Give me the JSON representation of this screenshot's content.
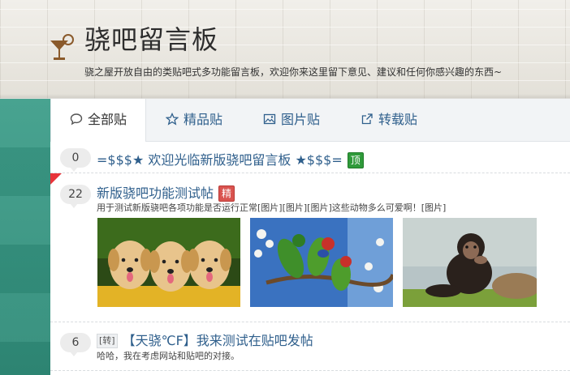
{
  "header": {
    "title": "骁吧留言板",
    "description": "骁之屋开放自由的类贴吧式多功能留言板，欢迎你来这里留下意见、建议和任何你感兴趣的东西~"
  },
  "tabs": [
    {
      "label": "全部贴",
      "icon": "chat-bubble-icon",
      "active": true
    },
    {
      "label": "精品贴",
      "icon": "star-icon",
      "active": false
    },
    {
      "label": "图片贴",
      "icon": "image-icon",
      "active": false
    },
    {
      "label": "转载贴",
      "icon": "external-link-icon",
      "active": false
    }
  ],
  "posts": [
    {
      "reply_count": "0",
      "title": "=$$$★ 欢迎光临新版骁吧留言板 ★$$$=",
      "badge": "顶"
    },
    {
      "reply_count": "22",
      "title": "新版骁吧功能测试帖",
      "badge": "精",
      "summary": "用于测试新版骁吧各项功能是否运行正常[图片][图片][图片]这些动物多么可爱啊！[图片]",
      "images": [
        "puppies-image",
        "parrots-image",
        "chimpanzee-image"
      ]
    },
    {
      "reply_count": "6",
      "tag": "[转]",
      "title": "【天骁℃F】我来测试在贴吧发帖",
      "summary": "哈哈，我在考虑网站和贴吧的对接。"
    }
  ],
  "colors": {
    "link": "#2f5f8c",
    "teal": "#2f8b78",
    "top_badge": "#2f9a3a",
    "jing_badge": "#d9534f"
  }
}
